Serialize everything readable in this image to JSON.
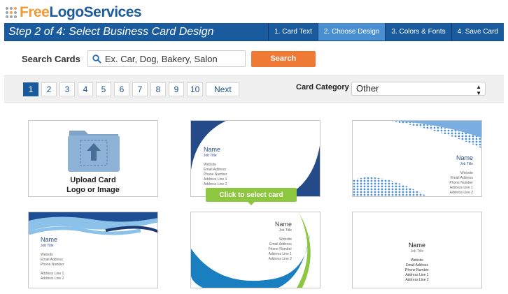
{
  "logo": {
    "part1": "Free",
    "part2": "LogoServices"
  },
  "header": {
    "title": "Step 2 of 4: Select Business Card Design",
    "steps": [
      {
        "label": "1. Card Text"
      },
      {
        "label": "2. Choose Design"
      },
      {
        "label": "3. Colors & Fonts"
      },
      {
        "label": "4. Save Card"
      }
    ]
  },
  "search": {
    "label": "Search Cards",
    "placeholder": "Ex. Car, Dog, Bakery, Salon",
    "button": "Search"
  },
  "pagination": {
    "pages": [
      "1",
      "2",
      "3",
      "4",
      "5",
      "6",
      "7",
      "8",
      "9",
      "10"
    ],
    "current": "1",
    "next": "Next"
  },
  "category": {
    "label": "Card Category",
    "selected": "Other"
  },
  "upload": {
    "line1": "Upload Card",
    "line2": "Logo or Image"
  },
  "card_text": {
    "name": "Name",
    "job": "Job Title",
    "website": "Website",
    "email": "Email Address",
    "phone": "Phone Number",
    "addr1": "Address Line 1",
    "addr2": "Address Line 2"
  },
  "tooltip": "Click to select card"
}
